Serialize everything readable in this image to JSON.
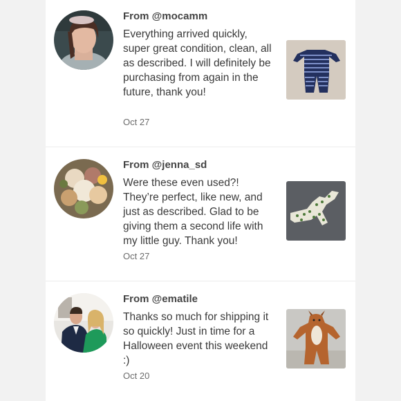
{
  "reviews": [
    {
      "from": "From @mocamm",
      "text": "Everything arrived quickly, super great condition, clean, all as described. I will definitely be purchasing from again in the future, thank you!",
      "date": "Oct 27",
      "avatar_icon": "user-avatar-photo",
      "item_icon": "striped-pajama-photo"
    },
    {
      "from": "From @jenna_sd",
      "text": "Were these even used?! They’re perfect, like new, and just as described. Glad to be giving them a second life with my little guy. Thank you!",
      "date": "Oct 27",
      "avatar_icon": "flower-bouquet-avatar",
      "item_icon": "dinosaur-pajama-photo"
    },
    {
      "from": "From @ematile",
      "text": "Thanks so much for shipping it so quickly! Just in time for a Halloween event this weekend :)",
      "date": "Oct 20",
      "avatar_icon": "couple-avatar-photo",
      "item_icon": "deer-costume-photo"
    }
  ]
}
